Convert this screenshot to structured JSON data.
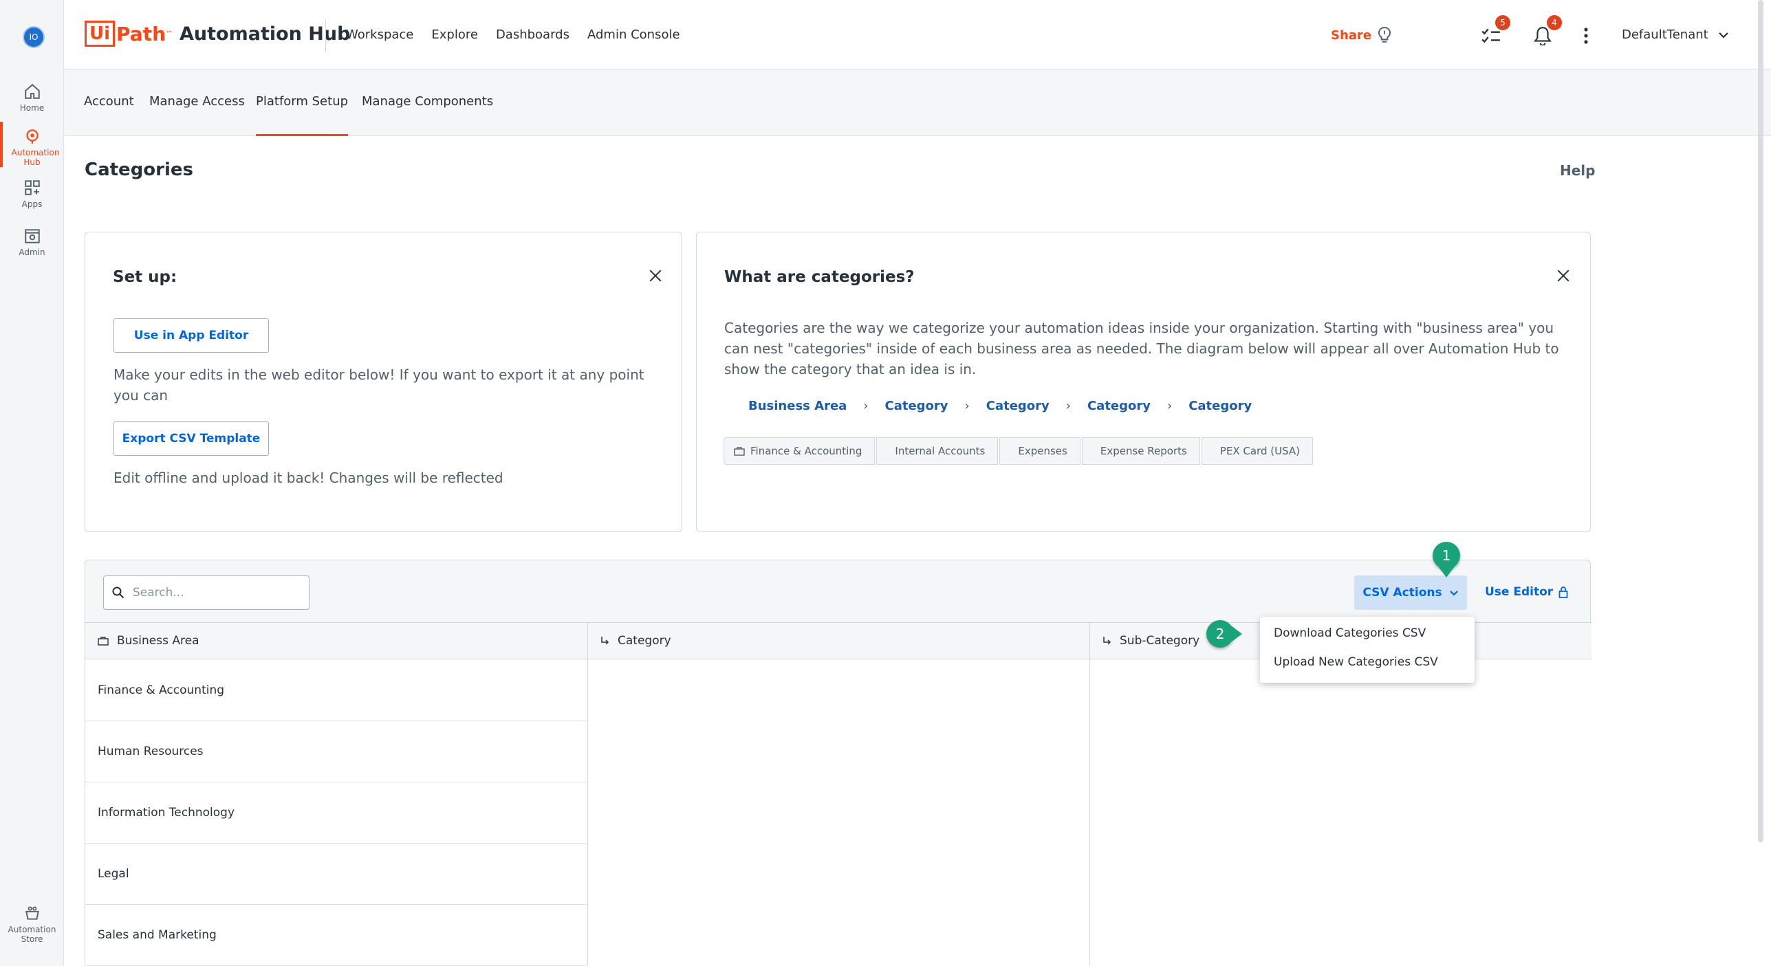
{
  "rail": {
    "avatar": "IO",
    "items": [
      {
        "label": "Home"
      },
      {
        "label": "Automation Hub"
      },
      {
        "label": "Apps"
      },
      {
        "label": "Admin"
      },
      {
        "label": "Automation Store"
      }
    ]
  },
  "header": {
    "logo_ui": "Ui",
    "logo_path": "Path",
    "logo_tm": "™",
    "logo_product": "Automation Hub",
    "nav": [
      "Workspace",
      "Explore",
      "Dashboards",
      "Admin Console"
    ],
    "share_label": "Share",
    "tasks_badge": "5",
    "notifications_badge": "4",
    "tenant": "DefaultTenant"
  },
  "subtabs": [
    {
      "label": "Account"
    },
    {
      "label": "Manage Access"
    },
    {
      "label": "Platform Setup",
      "active": true
    },
    {
      "label": "Manage Components"
    }
  ],
  "page": {
    "title": "Categories",
    "help": "Help"
  },
  "setup_card": {
    "title": "Set up:",
    "app_editor_btn": "Use in App Editor",
    "edit_text": "Make your edits in the web editor below! If you want to export it at any point you can",
    "export_btn": "Export CSV Template",
    "offline_text": "Edit offline and upload it back! Changes will be reflected"
  },
  "info_card": {
    "title": "What are categories?",
    "description": "Categories are the way we categorize your automation ideas inside your organization. Starting with \"business area\" you can nest \"categories\" inside of each business area as needed. The diagram below will appear all over Automation Hub to show the category that an idea is in.",
    "crumbs": [
      "Business Area",
      "Category",
      "Category",
      "Category",
      "Category"
    ],
    "chips": [
      "Finance & Accounting",
      "Internal Accounts",
      "Expenses",
      "Expense Reports",
      "PEX Card (USA)"
    ]
  },
  "table": {
    "search_placeholder": "Search...",
    "csv_actions": "CSV Actions",
    "use_editor": "Use Editor",
    "columns": [
      "Business Area",
      "Category",
      "Sub-Category"
    ],
    "rows": [
      "Finance & Accounting",
      "Human Resources",
      "Information Technology",
      "Legal",
      "Sales and Marketing"
    ]
  },
  "csv_menu": {
    "items": [
      "Download Categories CSV",
      "Upload New Categories CSV"
    ]
  },
  "callouts": [
    "1",
    "2"
  ],
  "colors": {
    "brand": "#fa4616",
    "link": "#0067df",
    "callout": "#1aa37a",
    "badge": "#e0431b"
  }
}
